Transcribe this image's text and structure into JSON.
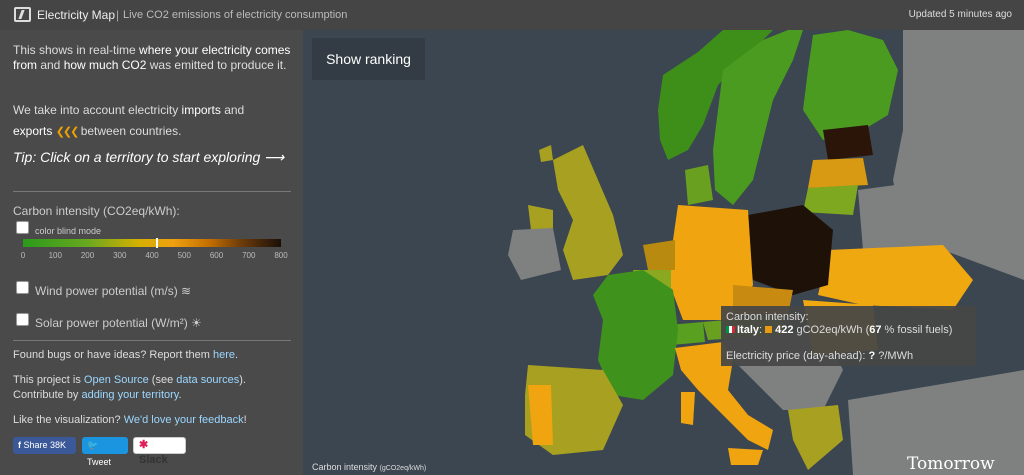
{
  "header": {
    "app_title": "Electricity Map",
    "separator": "|",
    "subtitle": "Live CO2 emissions of electricity consumption",
    "updated": "Updated 5 minutes ago"
  },
  "sidebar": {
    "intro_1a": "This shows in real-time ",
    "intro_1b": "where your electricity comes from",
    "intro_1c": " and ",
    "intro_1d": "how much CO2",
    "intro_1e": " was emitted to produce it.",
    "intro_2a": "We take into account electricity ",
    "intro_2b": "imports",
    "intro_2c": " and ",
    "intro_2d": "exports",
    "intro_2e": " between countries.",
    "arrows": "❮❮❮",
    "tip": "Tip: Click on a territory to start exploring ⟶",
    "carbon_intensity_label": "Carbon intensity (CO2eq/kWh):",
    "color_blind_label": "color blind mode",
    "scale_ticks": [
      "0",
      "100",
      "200",
      "300",
      "400",
      "500",
      "600",
      "700",
      "800"
    ],
    "scale_marker_value": 415,
    "wind_label": "Wind power potential (m/s) ≋",
    "solar_label": "Solar power potential (W/m²) ☀",
    "bugs_text": "Found bugs or have ideas? Report them ",
    "bugs_link": "here",
    "bugs_end": ".",
    "oss_a": "This project is ",
    "oss_link1": "Open Source",
    "oss_b": " (see ",
    "oss_link2": "data sources",
    "oss_c": "). Contribute by ",
    "oss_link3": "adding your territory",
    "oss_d": ".",
    "like_a": "Like the visualization? ",
    "like_link": "We'd love your feedback",
    "like_b": "!",
    "share_fb": "Share 38K",
    "share_tw": "Tweet",
    "share_slack": "Slack"
  },
  "map": {
    "show_ranking": "Show ranking",
    "caption": "Carbon intensity",
    "caption_unit": "(gCO2eq/kWh)",
    "watermark": "Tomorrow",
    "tooltip": {
      "line1": "Carbon intensity:",
      "country": "Italy",
      "intensity": "422",
      "intensity_unit": " gCO2eq/kWh (",
      "fossil": "67",
      "fossil_unit": " % fossil fuels)",
      "price_label": "Electricity price (day-ahead): ",
      "price": "?",
      "price_unit": " ?/MWh"
    }
  },
  "colors": {
    "low": "#2a9a1a",
    "mid": "#d6b000",
    "high": "#1a1008",
    "accent": "#f0a000"
  }
}
